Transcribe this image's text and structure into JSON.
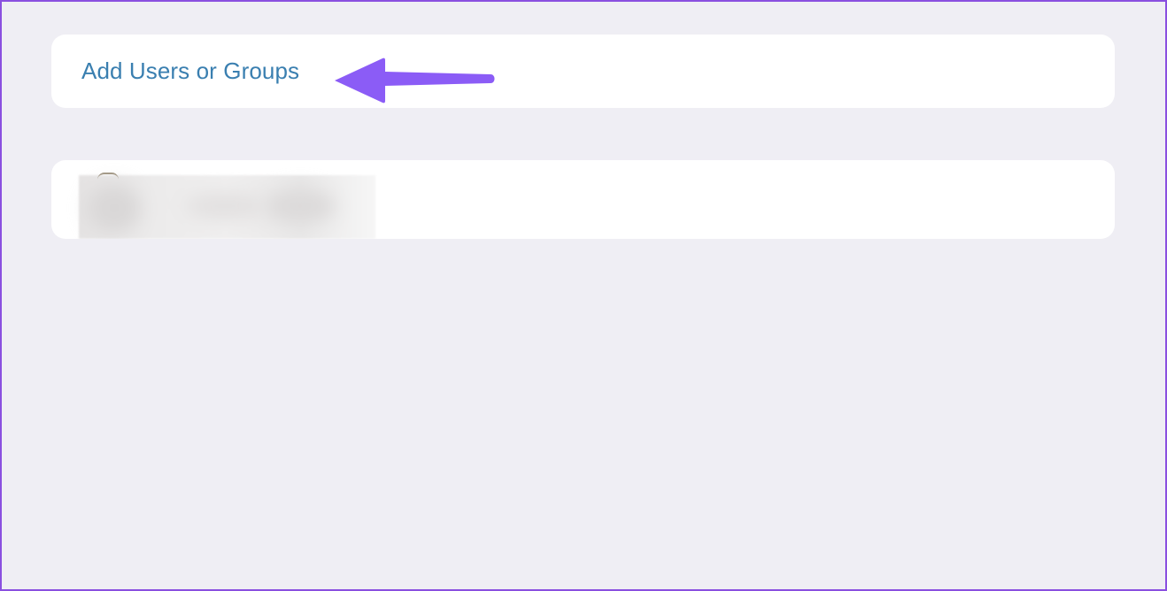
{
  "add_users": {
    "label": "Add Users or Groups"
  },
  "annotation": {
    "arrow_color": "#8b5cf6",
    "icon": "arrow-left-icon"
  },
  "colors": {
    "background": "#efeef4",
    "card": "#ffffff",
    "link": "#3a7fb0",
    "frame_border": "#8a4fe0"
  }
}
